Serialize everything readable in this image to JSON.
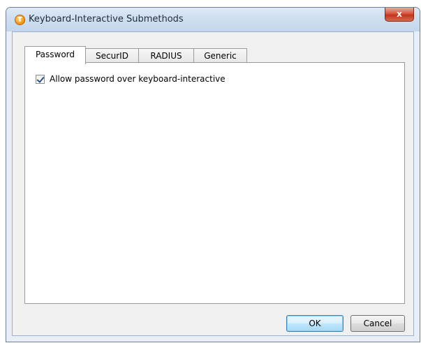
{
  "window": {
    "title": "Keyboard-Interactive Submethods",
    "app_icon_glyph": "T",
    "close_glyph": "x"
  },
  "tabs": [
    {
      "label": "Password",
      "active": true
    },
    {
      "label": "SecurID",
      "active": false
    },
    {
      "label": "RADIUS",
      "active": false
    },
    {
      "label": "Generic",
      "active": false
    }
  ],
  "password_tab": {
    "allow_password_label": "Allow password over keyboard-interactive",
    "allow_password_checked": true
  },
  "buttons": {
    "ok_label": "OK",
    "cancel_label": "Cancel"
  },
  "icons": {
    "app": "tectia-logo-icon",
    "close": "close-icon",
    "check": "checkmark-icon"
  },
  "colors": {
    "title_bar": "#cfdff0",
    "close_button": "#c4361f",
    "dialog_background": "#f0f0f0",
    "default_button_border": "#3c7fb1"
  }
}
